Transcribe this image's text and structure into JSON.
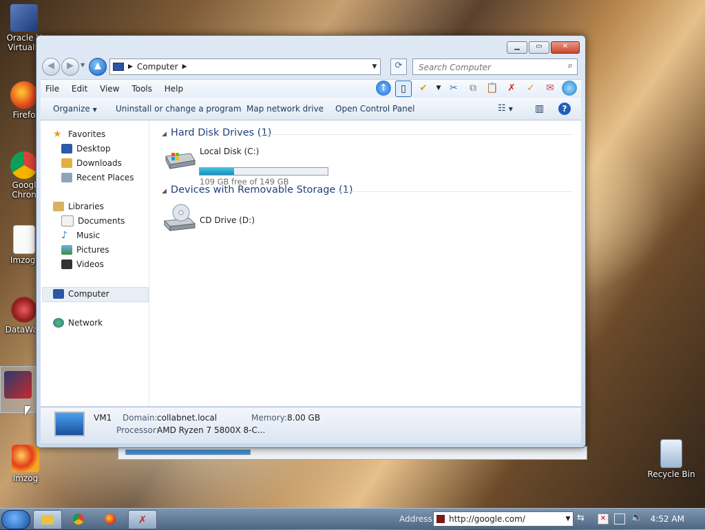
{
  "desktop": {
    "icons": [
      {
        "label": "Oracle VM VirtualBox",
        "short": "Oracle V\nVirtualB"
      },
      {
        "label": "Firefox",
        "short": "Firefo"
      },
      {
        "label": "Google Chrome",
        "short": "Googl\nChron"
      },
      {
        "label": "Imzog",
        "short": "Imzog."
      },
      {
        "label": "DataWag",
        "short": "DataWag"
      },
      {
        "label": "Imzog",
        "short": "Imzog"
      },
      {
        "label": "Recycle Bin",
        "short": "Recycle Bin"
      }
    ]
  },
  "window": {
    "address": {
      "path": "Computer"
    },
    "search": {
      "placeholder": "Search Computer"
    },
    "menu": [
      "File",
      "Edit",
      "View",
      "Tools",
      "Help"
    ],
    "commands": {
      "organize": "Organize",
      "uninstall": "Uninstall or change a program",
      "map_drive": "Map network drive",
      "control_panel": "Open Control Panel"
    },
    "nav": {
      "favorites": "Favorites",
      "desktop": "Desktop",
      "downloads": "Downloads",
      "recent": "Recent Places",
      "libraries": "Libraries",
      "documents": "Documents",
      "music": "Music",
      "pictures": "Pictures",
      "videos": "Videos",
      "computer": "Computer",
      "network": "Network"
    },
    "content": {
      "hdd_group": "Hard Disk Drives (1)",
      "removable_group": "Devices with Removable Storage (1)",
      "local_disk": {
        "name": "Local Disk (C:)",
        "free": "109 GB free of 149 GB",
        "used_fraction": 0.27
      },
      "cd_drive": {
        "name": "CD Drive (D:)"
      }
    },
    "status": {
      "name": "VM1",
      "domain_label": "Domain:",
      "domain": "collabnet.local",
      "memory_label": "Memory:",
      "memory": "8.00 GB",
      "processor_label": "Processor:",
      "processor": "AMD Ryzen 7 5800X 8-C..."
    }
  },
  "taskbar": {
    "address_label": "Address",
    "address_value": "http://google.com/",
    "clock": "4:52 AM"
  }
}
